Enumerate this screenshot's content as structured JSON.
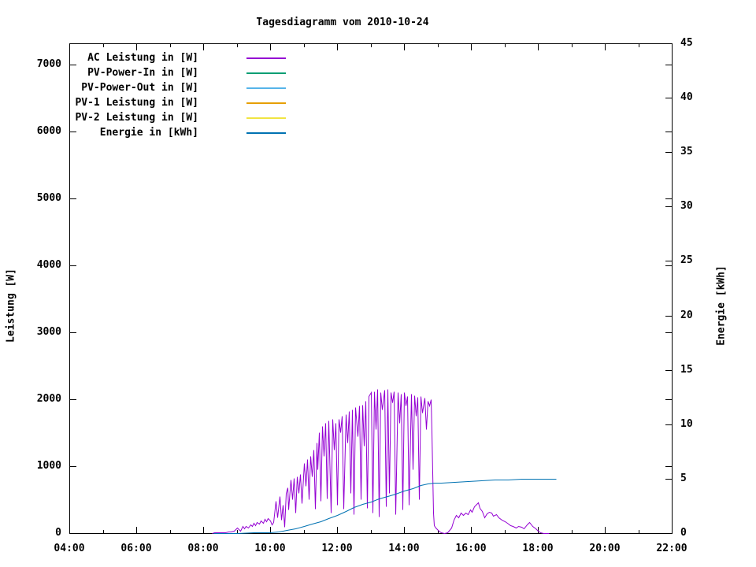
{
  "chart_data": {
    "type": "line",
    "title": "Tagesdiagramm vom 2010-10-24",
    "y_left_label": "Leistung [W]",
    "y_right_label": "Energie [kWh]",
    "background": "#ffffff",
    "grid": false,
    "legend_position": "top-left-inside",
    "x_range": [
      4,
      22
    ],
    "x_major": [
      4,
      6,
      8,
      10,
      12,
      14,
      16,
      18,
      20,
      22
    ],
    "x_minor": [
      5,
      7,
      9,
      11,
      13,
      15,
      17,
      19,
      21
    ],
    "x_tick_labels": [
      "04:00",
      "06:00",
      "08:00",
      "10:00",
      "12:00",
      "14:00",
      "16:00",
      "18:00",
      "20:00",
      "22:00"
    ],
    "y_left": {
      "ticks": [
        0,
        1000,
        2000,
        3000,
        4000,
        5000,
        6000,
        7000
      ],
      "labels": [
        "0",
        "1000",
        "2000",
        "3000",
        "4000",
        "5000",
        "6000",
        "7000"
      ],
      "range": [
        0,
        7317
      ]
    },
    "y_right": {
      "ticks": [
        0,
        5,
        10,
        15,
        20,
        25,
        30,
        35,
        40,
        45
      ],
      "labels": [
        "0",
        "5",
        "10",
        "15",
        "20",
        "25",
        "30",
        "35",
        "40",
        "45"
      ],
      "range": [
        0,
        45
      ]
    },
    "series": [
      {
        "name": "AC Leistung in [W]",
        "color": "#9400d3",
        "axis": "y1",
        "points": [
          [
            8.25,
            0
          ],
          [
            8.33,
            6
          ],
          [
            8.42,
            12
          ],
          [
            8.5,
            8
          ],
          [
            8.58,
            16
          ],
          [
            8.67,
            12
          ],
          [
            8.75,
            24
          ],
          [
            8.83,
            18
          ],
          [
            8.92,
            30
          ],
          [
            9.0,
            85
          ],
          [
            9.05,
            55
          ],
          [
            9.1,
            40
          ],
          [
            9.17,
            100
          ],
          [
            9.22,
            70
          ],
          [
            9.28,
            110
          ],
          [
            9.33,
            88
          ],
          [
            9.4,
            130
          ],
          [
            9.45,
            100
          ],
          [
            9.5,
            150
          ],
          [
            9.55,
            118
          ],
          [
            9.6,
            170
          ],
          [
            9.67,
            140
          ],
          [
            9.72,
            188
          ],
          [
            9.78,
            158
          ],
          [
            9.83,
            210
          ],
          [
            9.88,
            172
          ],
          [
            9.93,
            220
          ],
          [
            10.0,
            190
          ],
          [
            10.05,
            130
          ],
          [
            10.1,
            160
          ],
          [
            10.17,
            480
          ],
          [
            10.22,
            240
          ],
          [
            10.28,
            550
          ],
          [
            10.33,
            200
          ],
          [
            10.38,
            420
          ],
          [
            10.42,
            90
          ],
          [
            10.47,
            600
          ],
          [
            10.52,
            680
          ],
          [
            10.55,
            350
          ],
          [
            10.6,
            800
          ],
          [
            10.65,
            500
          ],
          [
            10.7,
            820
          ],
          [
            10.75,
            300
          ],
          [
            10.8,
            850
          ],
          [
            10.85,
            600
          ],
          [
            10.9,
            880
          ],
          [
            10.95,
            450
          ],
          [
            11.0,
            1050
          ],
          [
            11.05,
            700
          ],
          [
            11.1,
            1100
          ],
          [
            11.15,
            500
          ],
          [
            11.2,
            1150
          ],
          [
            11.25,
            850
          ],
          [
            11.3,
            1250
          ],
          [
            11.33,
            360
          ],
          [
            11.38,
            1350
          ],
          [
            11.42,
            950
          ],
          [
            11.47,
            1500
          ],
          [
            11.5,
            480
          ],
          [
            11.55,
            1600
          ],
          [
            11.6,
            1150
          ],
          [
            11.65,
            1650
          ],
          [
            11.7,
            520
          ],
          [
            11.75,
            1680
          ],
          [
            11.8,
            300
          ],
          [
            11.85,
            1700
          ],
          [
            11.9,
            1250
          ],
          [
            11.95,
            1650
          ],
          [
            12.0,
            420
          ],
          [
            12.05,
            1700
          ],
          [
            12.1,
            1500
          ],
          [
            12.15,
            1750
          ],
          [
            12.2,
            360
          ],
          [
            12.25,
            1780
          ],
          [
            12.3,
            1350
          ],
          [
            12.35,
            1820
          ],
          [
            12.4,
            600
          ],
          [
            12.45,
            1850
          ],
          [
            12.5,
            280
          ],
          [
            12.55,
            1880
          ],
          [
            12.6,
            1450
          ],
          [
            12.65,
            1900
          ],
          [
            12.7,
            500
          ],
          [
            12.75,
            1920
          ],
          [
            12.8,
            1300
          ],
          [
            12.85,
            1980
          ],
          [
            12.9,
            380
          ],
          [
            12.95,
            2050
          ],
          [
            13.0,
            2100
          ],
          [
            13.05,
            300
          ],
          [
            13.1,
            2120
          ],
          [
            13.15,
            1550
          ],
          [
            13.2,
            2150
          ],
          [
            13.25,
            250
          ],
          [
            13.3,
            2100
          ],
          [
            13.35,
            1850
          ],
          [
            13.4,
            2140
          ],
          [
            13.45,
            400
          ],
          [
            13.5,
            2150
          ],
          [
            13.55,
            600
          ],
          [
            13.6,
            2100
          ],
          [
            13.65,
            1950
          ],
          [
            13.7,
            2120
          ],
          [
            13.75,
            280
          ],
          [
            13.8,
            2100
          ],
          [
            13.85,
            1650
          ],
          [
            13.9,
            2080
          ],
          [
            13.95,
            350
          ],
          [
            14.0,
            2100
          ],
          [
            14.05,
            1900
          ],
          [
            14.1,
            2050
          ],
          [
            14.15,
            420
          ],
          [
            14.2,
            2080
          ],
          [
            14.25,
            950
          ],
          [
            14.3,
            2060
          ],
          [
            14.35,
            1750
          ],
          [
            14.4,
            2040
          ],
          [
            14.45,
            500
          ],
          [
            14.5,
            2050
          ],
          [
            14.55,
            1800
          ],
          [
            14.6,
            2020
          ],
          [
            14.65,
            1550
          ],
          [
            14.7,
            1980
          ],
          [
            14.75,
            1900
          ],
          [
            14.8,
            2000
          ],
          [
            14.83,
            1500
          ],
          [
            14.86,
            300
          ],
          [
            14.9,
            120
          ],
          [
            14.95,
            80
          ],
          [
            15.0,
            50
          ],
          [
            15.05,
            20
          ],
          [
            15.1,
            10
          ],
          [
            15.2,
            5
          ],
          [
            15.3,
            12
          ],
          [
            15.4,
            80
          ],
          [
            15.48,
            200
          ],
          [
            15.55,
            270
          ],
          [
            15.62,
            240
          ],
          [
            15.7,
            300
          ],
          [
            15.77,
            270
          ],
          [
            15.83,
            310
          ],
          [
            15.9,
            280
          ],
          [
            15.97,
            350
          ],
          [
            16.03,
            320
          ],
          [
            16.1,
            400
          ],
          [
            16.2,
            460
          ],
          [
            16.27,
            380
          ],
          [
            16.33,
            330
          ],
          [
            16.4,
            240
          ],
          [
            16.47,
            290
          ],
          [
            16.53,
            320
          ],
          [
            16.6,
            300
          ],
          [
            16.67,
            260
          ],
          [
            16.75,
            280
          ],
          [
            16.83,
            230
          ],
          [
            16.92,
            200
          ],
          [
            17.0,
            180
          ],
          [
            17.08,
            150
          ],
          [
            17.17,
            120
          ],
          [
            17.25,
            100
          ],
          [
            17.33,
            85
          ],
          [
            17.42,
            110
          ],
          [
            17.5,
            95
          ],
          [
            17.58,
            75
          ],
          [
            17.67,
            130
          ],
          [
            17.75,
            160
          ],
          [
            17.83,
            110
          ],
          [
            17.92,
            70
          ],
          [
            18.0,
            40
          ],
          [
            18.08,
            15
          ],
          [
            18.17,
            5
          ],
          [
            18.33,
            0
          ]
        ]
      },
      {
        "name": "PV-Power-In in [W]",
        "color": "#009e73",
        "axis": "y1",
        "points": []
      },
      {
        "name": "PV-Power-Out in [W]",
        "color": "#56b4e9",
        "axis": "y1",
        "points": []
      },
      {
        "name": "PV-1 Leistung in [W]",
        "color": "#e69f00",
        "axis": "y1",
        "points": []
      },
      {
        "name": "PV-2 Leistung in [W]",
        "color": "#f0e442",
        "axis": "y1",
        "points": []
      },
      {
        "name": "Energie in [kWh]",
        "color": "#0072b2",
        "axis": "y2",
        "points": [
          [
            8.3,
            0
          ],
          [
            9.0,
            0.02
          ],
          [
            9.5,
            0.04
          ],
          [
            10.0,
            0.07
          ],
          [
            10.25,
            0.15
          ],
          [
            10.5,
            0.28
          ],
          [
            10.75,
            0.45
          ],
          [
            11.0,
            0.62
          ],
          [
            11.25,
            0.85
          ],
          [
            11.5,
            1.1
          ],
          [
            11.75,
            1.4
          ],
          [
            12.0,
            1.7
          ],
          [
            12.25,
            2.05
          ],
          [
            12.5,
            2.4
          ],
          [
            12.75,
            2.65
          ],
          [
            13.0,
            2.9
          ],
          [
            13.25,
            3.15
          ],
          [
            13.5,
            3.4
          ],
          [
            13.75,
            3.65
          ],
          [
            14.0,
            3.9
          ],
          [
            14.25,
            4.15
          ],
          [
            14.5,
            4.4
          ],
          [
            14.7,
            4.55
          ],
          [
            14.9,
            4.62
          ],
          [
            15.1,
            4.65
          ],
          [
            15.5,
            4.7
          ],
          [
            15.9,
            4.78
          ],
          [
            16.3,
            4.85
          ],
          [
            16.7,
            4.9
          ],
          [
            17.1,
            4.93
          ],
          [
            17.5,
            4.96
          ],
          [
            17.9,
            4.99
          ],
          [
            18.2,
            5.0
          ],
          [
            18.55,
            5.0
          ]
        ]
      }
    ]
  }
}
